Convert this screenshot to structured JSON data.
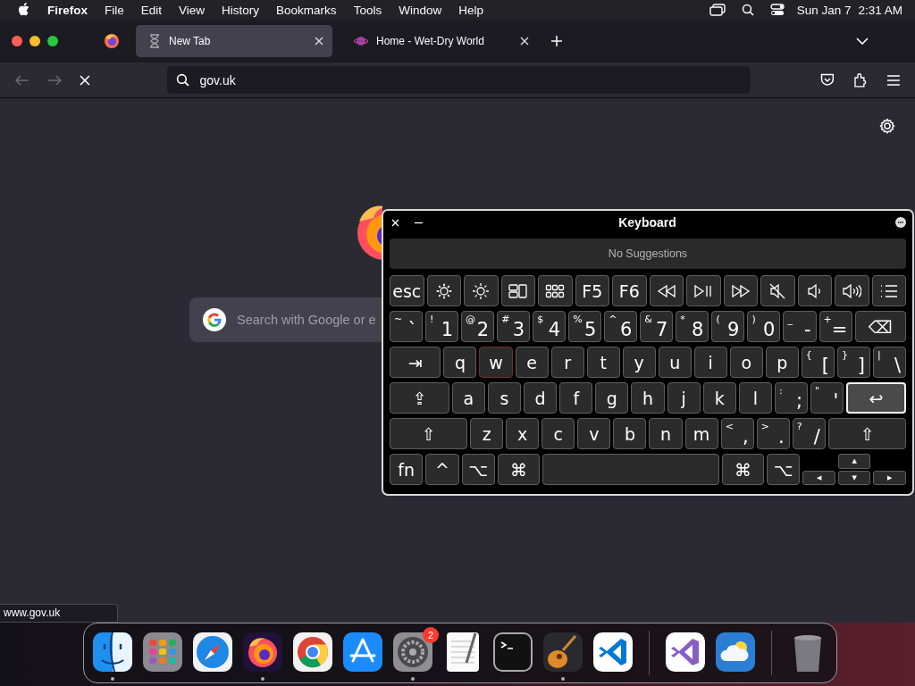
{
  "menu_bar": {
    "app_name": "Firefox",
    "menus": [
      "File",
      "Edit",
      "View",
      "History",
      "Bookmarks",
      "Tools",
      "Window",
      "Help"
    ],
    "date": "Sun Jan 7",
    "time": "2:31 AM"
  },
  "tabs": [
    {
      "title": "New Tab",
      "selected": true,
      "loading": true
    },
    {
      "title": "Home - Wet-Dry World",
      "selected": false,
      "loading": false
    }
  ],
  "toolbar": {
    "back_disabled": true,
    "forward_disabled": true,
    "url": "gov.uk"
  },
  "new_tab_page": {
    "search_placeholder": "Search with Google or e"
  },
  "status_link": "www.gov.uk",
  "keyboard": {
    "title": "Keyboard",
    "suggestions": "No Suggestions",
    "rows": [
      {
        "keys": [
          {
            "kind": "text",
            "label": "esc",
            "hover": false,
            "focus": false
          },
          {
            "kind": "dimmer",
            "hover": false,
            "focus": false
          },
          {
            "kind": "brighter",
            "hover": false,
            "focus": false
          },
          {
            "kind": "windows",
            "hover": false,
            "focus": false
          },
          {
            "kind": "apps",
            "hover": false,
            "focus": false
          },
          {
            "kind": "text",
            "label": "F5",
            "hover": false,
            "focus": false
          },
          {
            "kind": "text",
            "label": "F6",
            "hover": false,
            "focus": false
          },
          {
            "kind": "rewind",
            "hover": false,
            "focus": false
          },
          {
            "kind": "play",
            "hover": false,
            "focus": false
          },
          {
            "kind": "forward",
            "hover": false,
            "focus": false
          },
          {
            "kind": "mute",
            "hover": false,
            "focus": false
          },
          {
            "kind": "quieter",
            "hover": false,
            "focus": false
          },
          {
            "kind": "louder",
            "hover": false,
            "focus": false
          },
          {
            "kind": "list",
            "hover": false,
            "focus": false
          }
        ]
      },
      {
        "keys": [
          {
            "kind": "dual",
            "shift": "~",
            "label": "`",
            "hover": false,
            "focus": false
          },
          {
            "kind": "dual",
            "shift": "!",
            "label": "1",
            "hover": false,
            "focus": false
          },
          {
            "kind": "dual",
            "shift": "@",
            "label": "2",
            "hover": false,
            "focus": false
          },
          {
            "kind": "dual",
            "shift": "#",
            "label": "3",
            "hover": false,
            "focus": false
          },
          {
            "kind": "dual",
            "shift": "$",
            "label": "4",
            "hover": false,
            "focus": false
          },
          {
            "kind": "dual",
            "shift": "%",
            "label": "5",
            "hover": false,
            "focus": false
          },
          {
            "kind": "dual",
            "shift": "^",
            "label": "6",
            "hover": false,
            "focus": false
          },
          {
            "kind": "dual",
            "shift": "&",
            "label": "7",
            "hover": false,
            "focus": false
          },
          {
            "kind": "dual",
            "shift": "*",
            "label": "8",
            "hover": false,
            "focus": false
          },
          {
            "kind": "dual",
            "shift": "(",
            "label": "9",
            "hover": false,
            "focus": false
          },
          {
            "kind": "dual",
            "shift": ")",
            "label": "0",
            "hover": false,
            "focus": false
          },
          {
            "kind": "dual",
            "shift": "_",
            "label": "-",
            "hover": false,
            "focus": false
          },
          {
            "kind": "dual",
            "shift": "+",
            "label": "=",
            "hover": false,
            "focus": false
          },
          {
            "kind": "text",
            "label": "⌫",
            "hover": false,
            "focus": false
          }
        ]
      },
      {
        "keys": [
          {
            "kind": "text",
            "label": "⇥",
            "hover": false,
            "focus": false
          },
          {
            "kind": "text",
            "label": "q",
            "hover": false,
            "focus": false
          },
          {
            "kind": "text",
            "label": "w",
            "hover": true,
            "focus": false
          },
          {
            "kind": "text",
            "label": "e",
            "hover": false,
            "focus": false
          },
          {
            "kind": "text",
            "label": "r",
            "hover": false,
            "focus": false
          },
          {
            "kind": "text",
            "label": "t",
            "hover": false,
            "focus": false
          },
          {
            "kind": "text",
            "label": "y",
            "hover": false,
            "focus": false
          },
          {
            "kind": "text",
            "label": "u",
            "hover": false,
            "focus": false
          },
          {
            "kind": "text",
            "label": "i",
            "hover": false,
            "focus": false
          },
          {
            "kind": "text",
            "label": "o",
            "hover": false,
            "focus": false
          },
          {
            "kind": "text",
            "label": "p",
            "hover": false,
            "focus": false
          },
          {
            "kind": "dual",
            "shift": "{",
            "label": "[",
            "hover": false,
            "focus": false
          },
          {
            "kind": "dual",
            "shift": "}",
            "label": "]",
            "hover": false,
            "focus": false
          },
          {
            "kind": "dual",
            "shift": "|",
            "label": "\\",
            "hover": false,
            "focus": false
          }
        ]
      },
      {
        "keys": [
          {
            "kind": "text",
            "label": "⇪",
            "hover": false,
            "focus": false
          },
          {
            "kind": "text",
            "label": "a",
            "hover": false,
            "focus": false
          },
          {
            "kind": "text",
            "label": "s",
            "hover": false,
            "focus": false
          },
          {
            "kind": "text",
            "label": "d",
            "hover": false,
            "focus": false
          },
          {
            "kind": "text",
            "label": "f",
            "hover": false,
            "focus": false
          },
          {
            "kind": "text",
            "label": "g",
            "hover": false,
            "focus": false
          },
          {
            "kind": "text",
            "label": "h",
            "hover": false,
            "focus": false
          },
          {
            "kind": "text",
            "label": "j",
            "hover": false,
            "focus": false
          },
          {
            "kind": "text",
            "label": "k",
            "hover": false,
            "focus": false
          },
          {
            "kind": "text",
            "label": "l",
            "hover": false,
            "focus": false
          },
          {
            "kind": "dual",
            "shift": ":",
            "label": ";",
            "hover": false,
            "focus": false
          },
          {
            "kind": "dual",
            "shift": "\"",
            "label": "'",
            "hover": false,
            "focus": false
          },
          {
            "kind": "text",
            "label": "↩",
            "hover": false,
            "focus": true
          }
        ]
      },
      {
        "keys": [
          {
            "kind": "text",
            "label": "⇧",
            "hover": false,
            "focus": false
          },
          {
            "kind": "text",
            "label": "z",
            "hover": false,
            "focus": false
          },
          {
            "kind": "text",
            "label": "x",
            "hover": false,
            "focus": false
          },
          {
            "kind": "text",
            "label": "c",
            "hover": false,
            "focus": false
          },
          {
            "kind": "text",
            "label": "v",
            "hover": false,
            "focus": false
          },
          {
            "kind": "text",
            "label": "b",
            "hover": false,
            "focus": false
          },
          {
            "kind": "text",
            "label": "n",
            "hover": false,
            "focus": false
          },
          {
            "kind": "text",
            "label": "m",
            "hover": false,
            "focus": false
          },
          {
            "kind": "dual",
            "shift": "<",
            "label": ",",
            "hover": false,
            "focus": false
          },
          {
            "kind": "dual",
            "shift": ">",
            "label": ".",
            "hover": false,
            "focus": false
          },
          {
            "kind": "dual",
            "shift": "?",
            "label": "/",
            "hover": false,
            "focus": false
          },
          {
            "kind": "text",
            "label": "⇧",
            "hover": false,
            "focus": false
          }
        ]
      },
      {
        "keys": [
          {
            "kind": "text",
            "label": "fn",
            "hover": false,
            "focus": false
          },
          {
            "kind": "text",
            "label": "^",
            "hover": false,
            "focus": false
          },
          {
            "kind": "text",
            "label": "⌥",
            "hover": false,
            "focus": false
          },
          {
            "kind": "text",
            "label": "⌘",
            "hover": false,
            "focus": false
          },
          {
            "kind": "space",
            "hover": false,
            "focus": false
          },
          {
            "kind": "text",
            "label": "⌘",
            "hover": false,
            "focus": false
          },
          {
            "kind": "text",
            "label": "⌥",
            "hover": false,
            "focus": false
          },
          {
            "kind": "arrows",
            "hover": false,
            "focus": false,
            "up": "▲",
            "left": "◀",
            "down": "▼",
            "right": "▶"
          }
        ]
      }
    ]
  },
  "dock": {
    "groups": [
      [
        {
          "kind": "face",
          "running": true
        },
        {
          "kind": "tiles",
          "running": false
        },
        {
          "kind": "compass",
          "running": false
        },
        {
          "kind": "flame",
          "running": true
        },
        {
          "kind": "ring",
          "running": false
        },
        {
          "kind": "pencils",
          "running": false
        },
        {
          "kind": "gear",
          "running": true,
          "badge": "2"
        },
        {
          "kind": "notepad",
          "running": false
        },
        {
          "kind": "prompt",
          "running": false
        },
        {
          "kind": "guitar",
          "running": true
        },
        {
          "kind": "bluebow",
          "running": false
        }
      ],
      [
        {
          "kind": "purplebow",
          "running": false
        },
        {
          "kind": "cloud",
          "running": false
        }
      ],
      [
        {
          "kind": "bin",
          "running": false
        }
      ]
    ]
  }
}
